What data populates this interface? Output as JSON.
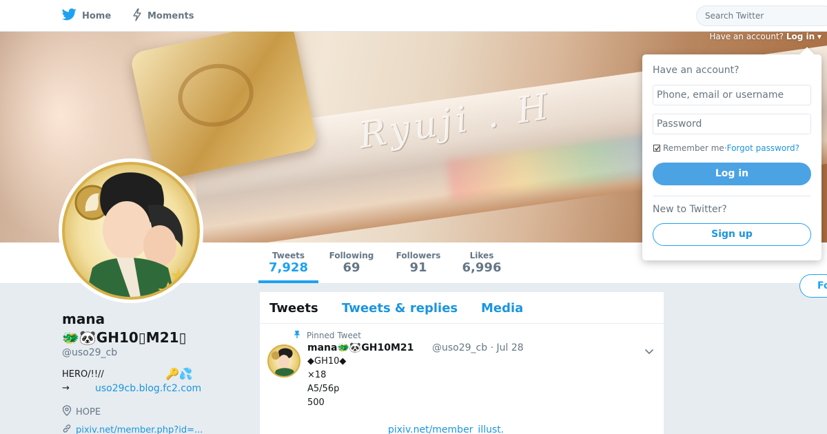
{
  "nav": {
    "home_label": "Home",
    "moments_label": "Moments",
    "search_placeholder": "Search Twitter"
  },
  "header": {
    "have_account_text": "Have an account?",
    "login_link": "Log in"
  },
  "banner": {
    "engraving": "Ryuji . H"
  },
  "stats": {
    "tweets_label": "Tweets",
    "tweets_value": "7,928",
    "following_label": "Following",
    "following_value": "69",
    "followers_label": "Followers",
    "followers_value": "91",
    "likes_label": "Likes",
    "likes_value": "6,996"
  },
  "follow_button": "Fo",
  "profile": {
    "name_line1": "mana",
    "name_line2": "🐲🐼GH10▯M21▯",
    "handle": "@uso29_cb",
    "bio_line1": "HERO/!!//",
    "bio_emoji": "🔑💦",
    "bio_line2": "→",
    "bio_link": "uso29cb.blog.fc2.com",
    "location": "HOPE",
    "url": "pixiv.net/member.php?id=..."
  },
  "timeline": {
    "tabs": [
      "Tweets",
      "Tweets & replies",
      "Media"
    ],
    "pinned_label": "Pinned Tweet",
    "tweet": {
      "author_name": "mana🐲🐼GH10M21",
      "meta": "@uso29_cb · Jul 28",
      "lines": [
        "◆GH10◆",
        "×18",
        "A5/56p",
        "500"
      ],
      "link": "pixiv.net/member_illust."
    }
  },
  "login_dropdown": {
    "title": "Have an account?",
    "username_placeholder": "Phone, email or username",
    "password_placeholder": "Password",
    "remember_me": "Remember me",
    "separator": " · ",
    "forgot_password": "Forgot password?",
    "login_button": "Log in",
    "new_to_twitter": "New to Twitter?",
    "signup_button": "Sign up"
  },
  "colors": {
    "brand_blue": "#1da1f2",
    "link_blue": "#1b95e0",
    "login_button_bg": "#4ba3e4",
    "page_bg": "#e6ecf0"
  }
}
